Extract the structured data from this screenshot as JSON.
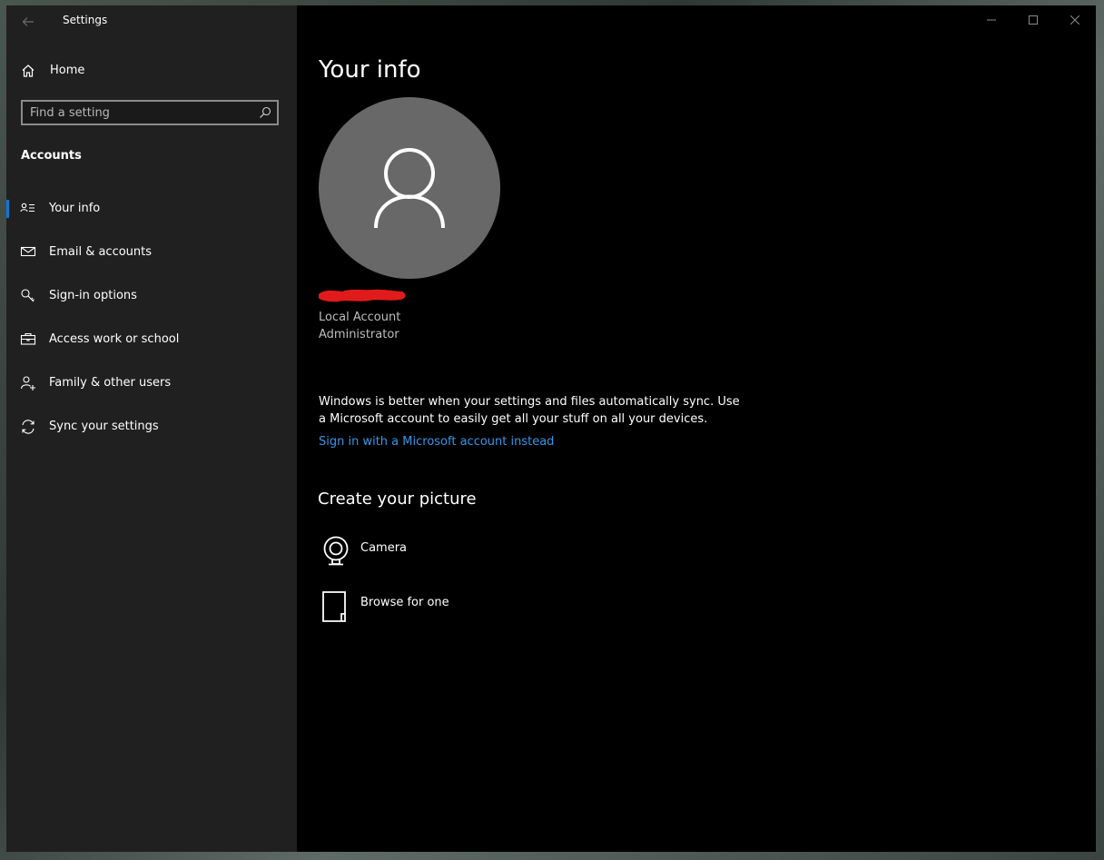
{
  "window": {
    "title": "Settings"
  },
  "sidebar": {
    "home_label": "Home",
    "search_placeholder": "Find a setting",
    "section_title": "Accounts",
    "items": [
      {
        "label": "Your info",
        "icon": "user-list-icon",
        "active": true
      },
      {
        "label": "Email & accounts",
        "icon": "mail-icon",
        "active": false
      },
      {
        "label": "Sign-in options",
        "icon": "key-icon",
        "active": false
      },
      {
        "label": "Access work or school",
        "icon": "briefcase-icon",
        "active": false
      },
      {
        "label": "Family & other users",
        "icon": "add-user-icon",
        "active": false
      },
      {
        "label": "Sync your settings",
        "icon": "sync-icon",
        "active": false
      }
    ]
  },
  "main": {
    "title": "Your info",
    "account_type": "Local Account",
    "account_role": "Administrator",
    "sync_message": "Windows is better when your settings and files automatically sync. Use a Microsoft account to easily get all your stuff on all your devices.",
    "ms_link": "Sign in with a Microsoft account instead",
    "create_picture_title": "Create your picture",
    "options": [
      {
        "label": "Camera",
        "icon": "camera-icon"
      },
      {
        "label": "Browse for one",
        "icon": "file-icon"
      }
    ]
  },
  "colors": {
    "accent": "#0a78d7",
    "link": "#3a96e8",
    "sidebar_bg": "#202020",
    "main_bg": "#000000",
    "avatar_bg": "#686868",
    "redaction": "#e01b1b"
  }
}
